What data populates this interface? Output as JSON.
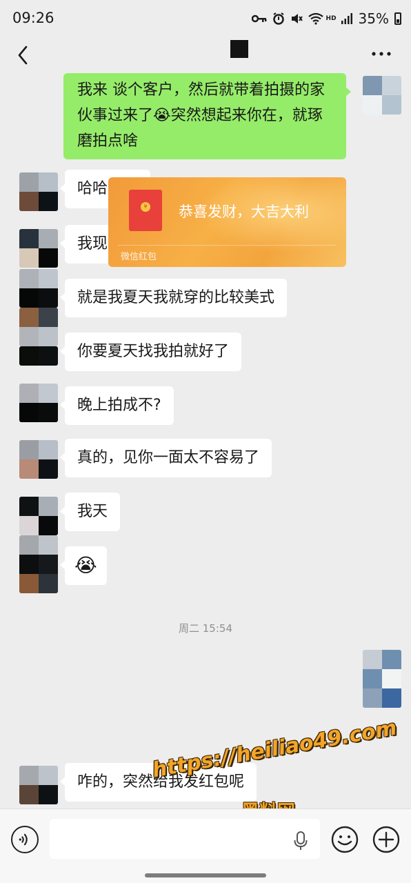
{
  "status_bar": {
    "time": "09:26",
    "icons": [
      "key-icon",
      "alarm-icon",
      "mute-icon",
      "wifi-icon",
      "hd-icon",
      "signal-icon"
    ],
    "hd_label": "HD",
    "battery": "35%"
  },
  "nav": {
    "back_icon": "back-arrow-icon",
    "more_icon": "more-dots-icon"
  },
  "messages": [
    {
      "side": "self",
      "text": "我来 谈个客户，然后就带着拍摄的家伙事过来了😭突然想起来你在，就琢磨拍点啥"
    },
    {
      "side": "other",
      "text": "哈哈哈哈"
    },
    {
      "side": "other",
      "text": "我现在走那种比较酷的风格"
    },
    {
      "side": "other",
      "text": "就是我夏天我就穿的比较美式"
    },
    {
      "side": "other",
      "text": "你要夏天找我拍就好了"
    },
    {
      "side": "other",
      "text": "晚上拍成不?"
    },
    {
      "side": "other",
      "text": "真的，见你一面太不容易了"
    },
    {
      "side": "other",
      "text": "我天"
    },
    {
      "side": "other",
      "text": "😭"
    },
    {
      "side": "other",
      "text": "咋的，突然给我发红包呢"
    }
  ],
  "timestamp": "周二 15:54",
  "red_packet": {
    "coin": "¥",
    "title": "恭喜发财，大吉大利",
    "footer": "微信红包"
  },
  "watermark": {
    "url": "https://heiliao49.com",
    "name": "黑料网"
  },
  "input_bar": {
    "voice_icon": "voice-icon",
    "mic_icon": "microphone-icon",
    "emoji_icon": "emoji-icon",
    "plus_icon": "plus-icon"
  },
  "colors": {
    "self_bubble": "#95ec69",
    "other_bubble": "#ffffff",
    "background": "#ededed",
    "red_packet": "#f3a53d",
    "watermark": "#f2a52a"
  }
}
